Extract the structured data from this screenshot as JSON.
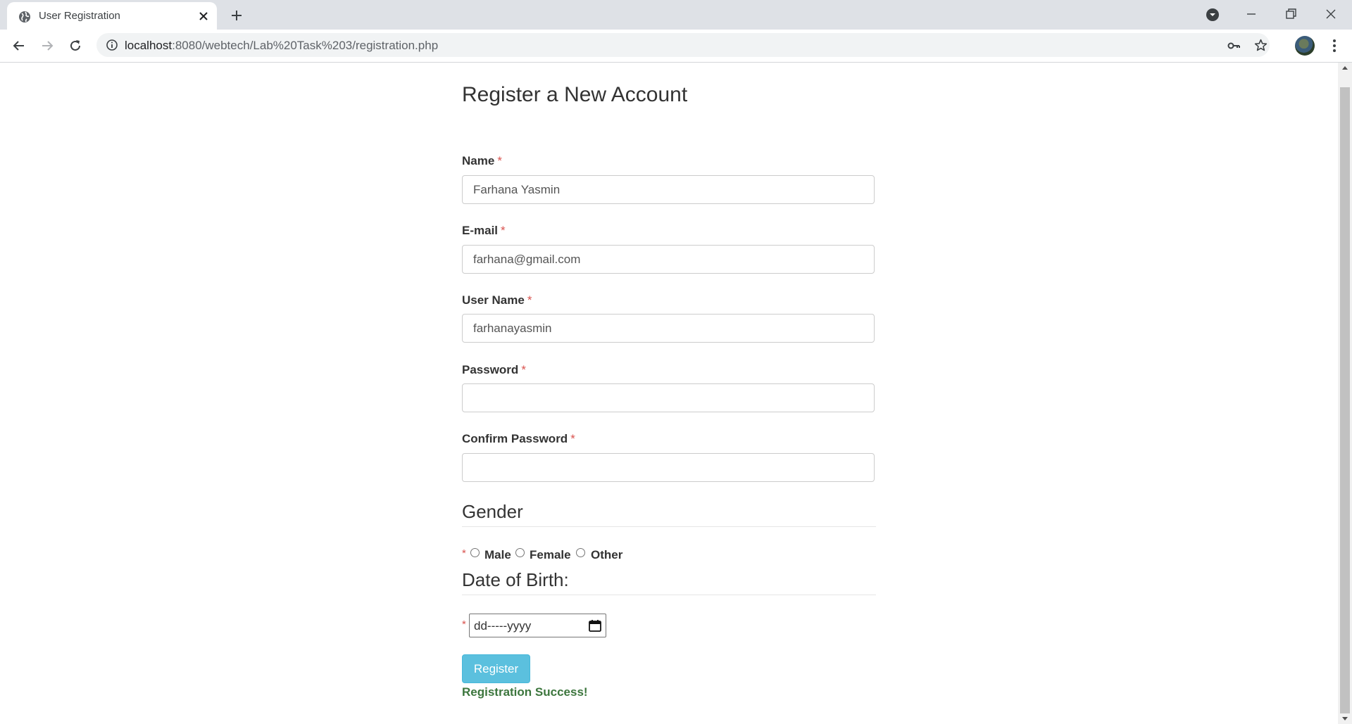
{
  "browser": {
    "tab_title": "User Registration",
    "url_host": "localhost",
    "url_rest": ":8080/webtech/Lab%20Task%203/registration.php"
  },
  "page": {
    "title": "Register a New Account",
    "required_marker": "*",
    "fields": [
      {
        "label": "Name",
        "value": "Farhana Yasmin",
        "type": "text"
      },
      {
        "label": "E-mail",
        "value": "farhana@gmail.com",
        "type": "text"
      },
      {
        "label": "User Name",
        "value": "farhanayasmin",
        "type": "text"
      },
      {
        "label": "Password",
        "value": "",
        "type": "password"
      },
      {
        "label": "Confirm Password",
        "value": "",
        "type": "password"
      }
    ],
    "gender": {
      "heading": "Gender",
      "options": [
        "Male",
        "Female",
        "Other"
      ]
    },
    "dob": {
      "heading": "Date of Birth:",
      "placeholder": "dd-----yyyy"
    },
    "register_label": "Register",
    "status_message": "Registration Success!",
    "colors": {
      "required": "#d9534f",
      "button": "#5bc0de",
      "success": "#3c763d"
    }
  }
}
